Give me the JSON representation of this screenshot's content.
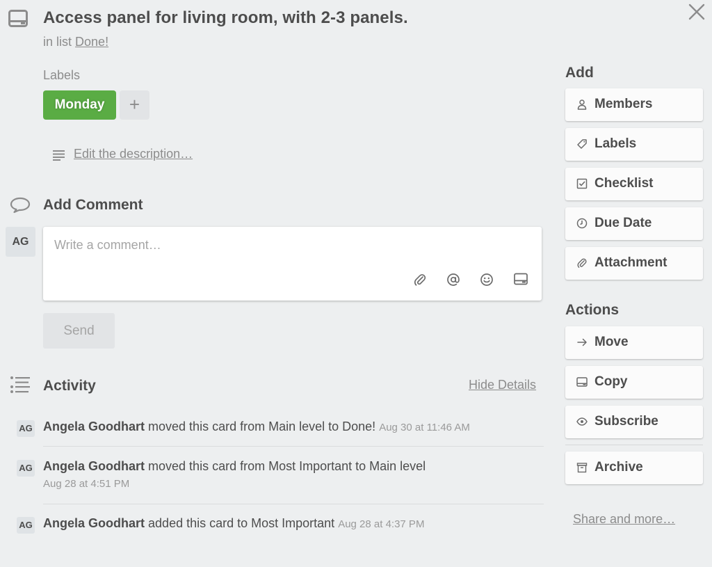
{
  "card": {
    "title": "Access panel for living room, with 2-3 panels.",
    "in_list_prefix": "in list",
    "list_name": "Done!"
  },
  "labels": {
    "heading": "Labels",
    "items": [
      {
        "text": "Monday",
        "color": "#5aac44"
      }
    ],
    "add_symbol": "+"
  },
  "description": {
    "link_text": "Edit the description…"
  },
  "comment": {
    "heading": "Add Comment",
    "avatar": "AG",
    "placeholder": "Write a comment…",
    "send_label": "Send",
    "toolbar_icons": [
      "paperclip-icon",
      "mention-icon",
      "emoji-icon",
      "card-icon"
    ]
  },
  "activity": {
    "heading": "Activity",
    "toggle_label": "Hide Details",
    "entries": [
      {
        "avatar": "AG",
        "user": "Angela Goodhart",
        "action": "moved this card from Main level to Done!",
        "date": "Aug 30 at 11:46 AM"
      },
      {
        "avatar": "AG",
        "user": "Angela Goodhart",
        "action": "moved this card from Most Important to Main level",
        "date": "Aug 28 at 4:51 PM"
      },
      {
        "avatar": "AG",
        "user": "Angela Goodhart",
        "action": "added this card to Most Important",
        "date": "Aug 28 at 4:37 PM"
      }
    ]
  },
  "sidebar": {
    "add_heading": "Add",
    "add_buttons": [
      {
        "label": "Members",
        "icon": "person-icon"
      },
      {
        "label": "Labels",
        "icon": "tag-icon"
      },
      {
        "label": "Checklist",
        "icon": "checkbox-icon"
      },
      {
        "label": "Due Date",
        "icon": "clock-icon"
      },
      {
        "label": "Attachment",
        "icon": "paperclip-icon"
      }
    ],
    "actions_heading": "Actions",
    "action_buttons": [
      {
        "label": "Move",
        "icon": "arrow-right-icon"
      },
      {
        "label": "Copy",
        "icon": "card-icon"
      },
      {
        "label": "Subscribe",
        "icon": "eye-icon"
      },
      {
        "label": "Archive",
        "icon": "archive-icon"
      }
    ],
    "share_link": "Share and more…"
  }
}
